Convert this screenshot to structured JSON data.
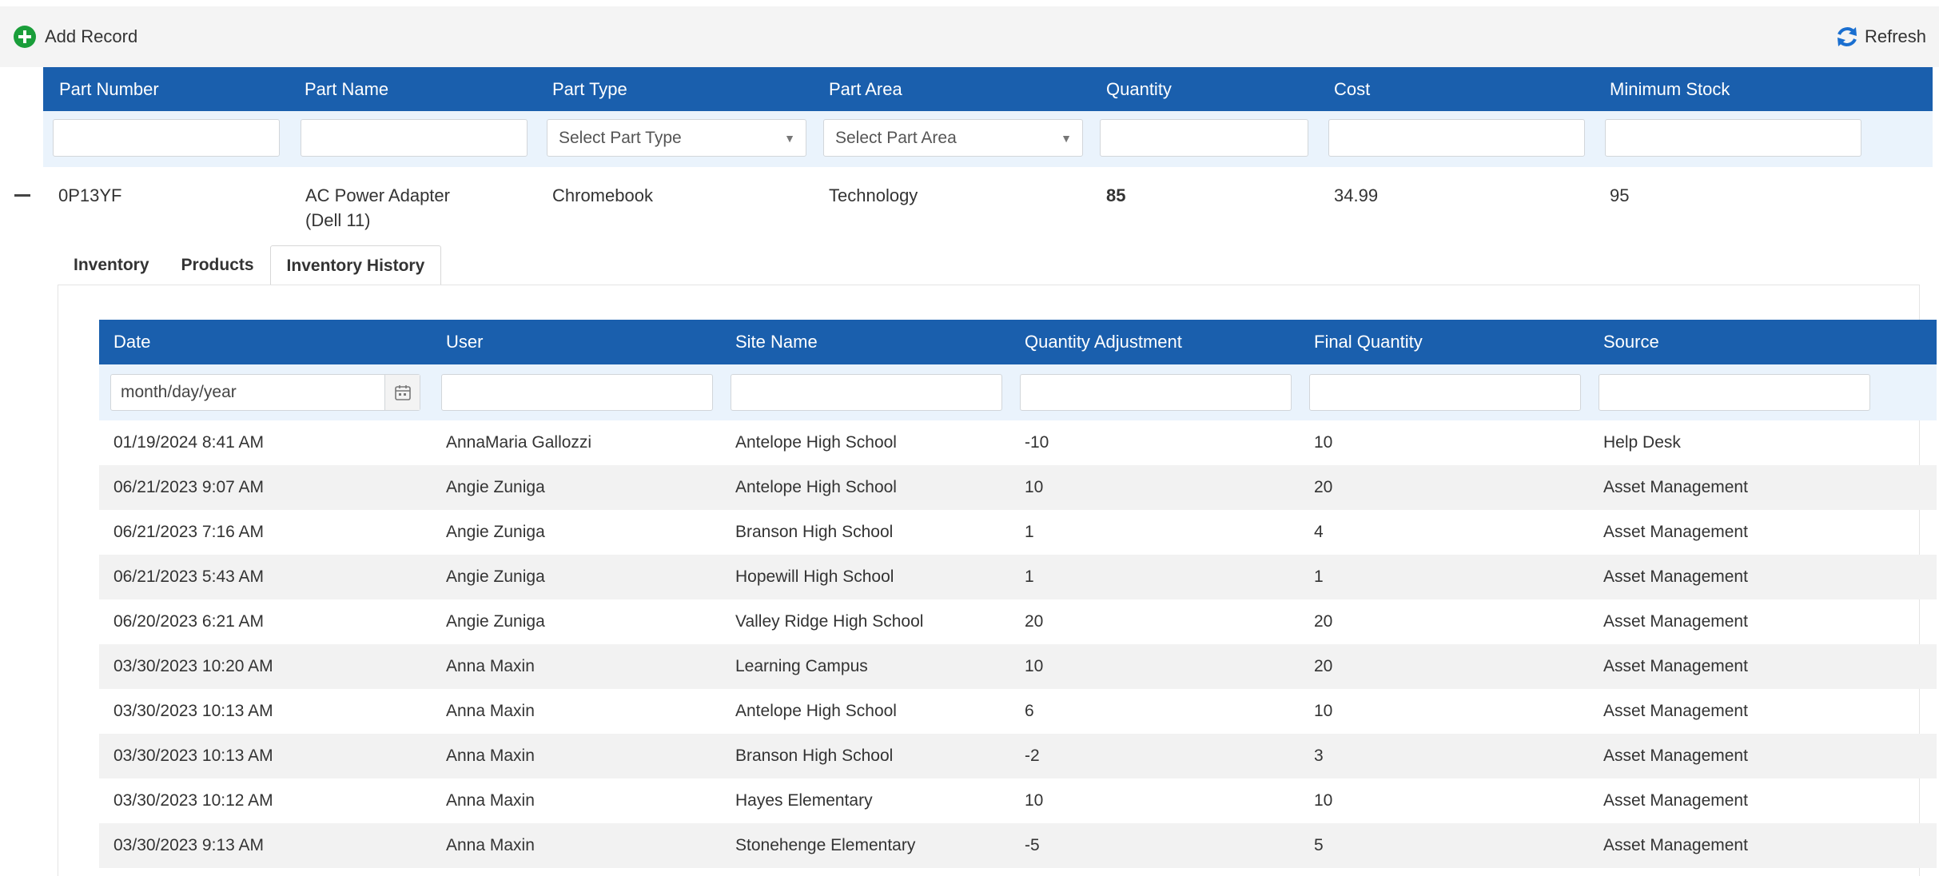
{
  "toolbar": {
    "add_label": "Add Record",
    "refresh_label": "Refresh",
    "add_icon": "plus-circle-icon",
    "refresh_icon": "refresh-icon",
    "accent_green": "#1a9e3a",
    "accent_blue": "#1a6fd0"
  },
  "outer_grid": {
    "header_color": "#1a5fad",
    "columns": [
      "Part Number",
      "Part Name",
      "Part Type",
      "Part Area",
      "Quantity",
      "Cost",
      "Minimum Stock"
    ],
    "filters": {
      "part_type_placeholder": "Select Part Type",
      "part_area_placeholder": "Select Part Area"
    },
    "row": {
      "part_number": "0P13YF",
      "part_name_line1": "AC Power Adapter",
      "part_name_line2": "(Dell 11)",
      "part_type": "Chromebook",
      "part_area": "Technology",
      "quantity": "85",
      "cost": "34.99",
      "minimum_stock": "95",
      "quantity_color": "#e02020"
    }
  },
  "tabs": [
    "Inventory",
    "Products",
    "Inventory History"
  ],
  "active_tab": "Inventory History",
  "history_grid": {
    "columns": [
      "Date",
      "User",
      "Site Name",
      "Quantity Adjustment",
      "Final Quantity",
      "Source"
    ],
    "date_placeholder": "month/day/year",
    "rows": [
      {
        "date": "01/19/2024 8:41 AM",
        "user": "AnnaMaria Gallozzi",
        "site": "Antelope High School",
        "adj": "-10",
        "final": "10",
        "source": "Help Desk"
      },
      {
        "date": "06/21/2023 9:07 AM",
        "user": "Angie Zuniga",
        "site": "Antelope High School",
        "adj": "10",
        "final": "20",
        "source": "Asset Management"
      },
      {
        "date": "06/21/2023 7:16 AM",
        "user": "Angie Zuniga",
        "site": "Branson High School",
        "adj": "1",
        "final": "4",
        "source": "Asset Management"
      },
      {
        "date": "06/21/2023 5:43 AM",
        "user": "Angie Zuniga",
        "site": "Hopewill High School",
        "adj": "1",
        "final": "1",
        "source": "Asset Management"
      },
      {
        "date": "06/20/2023 6:21 AM",
        "user": "Angie Zuniga",
        "site": "Valley Ridge High School",
        "adj": "20",
        "final": "20",
        "source": "Asset Management"
      },
      {
        "date": "03/30/2023 10:20 AM",
        "user": "Anna Maxin",
        "site": "Learning Campus",
        "adj": "10",
        "final": "20",
        "source": "Asset Management"
      },
      {
        "date": "03/30/2023 10:13 AM",
        "user": "Anna Maxin",
        "site": "Antelope High School",
        "adj": "6",
        "final": "10",
        "source": "Asset Management"
      },
      {
        "date": "03/30/2023 10:13 AM",
        "user": "Anna Maxin",
        "site": "Branson High School",
        "adj": "-2",
        "final": "3",
        "source": "Asset Management"
      },
      {
        "date": "03/30/2023 10:12 AM",
        "user": "Anna Maxin",
        "site": "Hayes Elementary",
        "adj": "10",
        "final": "10",
        "source": "Asset Management"
      },
      {
        "date": "03/30/2023 9:13 AM",
        "user": "Anna Maxin",
        "site": "Stonehenge Elementary",
        "adj": "-5",
        "final": "5",
        "source": "Asset Management"
      }
    ]
  }
}
